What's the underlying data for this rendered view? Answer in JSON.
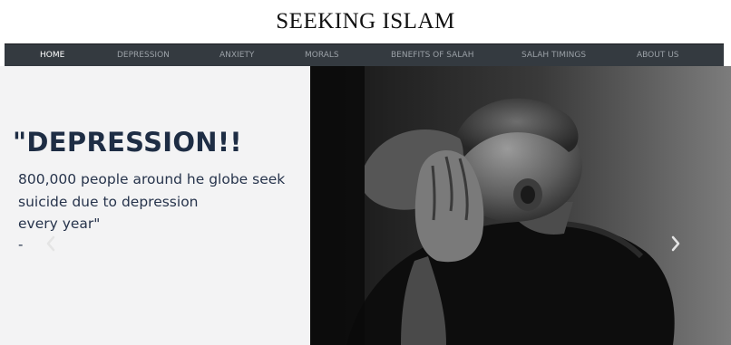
{
  "site": {
    "title": "SEEKING ISLAM"
  },
  "nav": {
    "items": [
      {
        "label": "HOME",
        "active": true
      },
      {
        "label": "DEPRESSION"
      },
      {
        "label": "ANXIETY"
      },
      {
        "label": "MORALS"
      },
      {
        "label": "BENEFITS OF SALAH"
      },
      {
        "label": "SALAH TIMINGS"
      },
      {
        "label": "ABOUT US"
      }
    ]
  },
  "hero": {
    "heading": "\"DEPRESSION!!",
    "lines": [
      "800,000 people around he globe seek",
      "suicide due to depression",
      "every year\""
    ],
    "dash": "-",
    "prev_icon": "chevron-left-icon",
    "next_icon": "chevron-right-icon",
    "photo": "man-holding-head-photo"
  },
  "colors": {
    "navbar_bg": "#343a40",
    "nav_text": "#9aa0a6",
    "nav_active": "#ffffff",
    "heading": "#1e2d44",
    "hero_left_bg": "#f3f3f4"
  }
}
